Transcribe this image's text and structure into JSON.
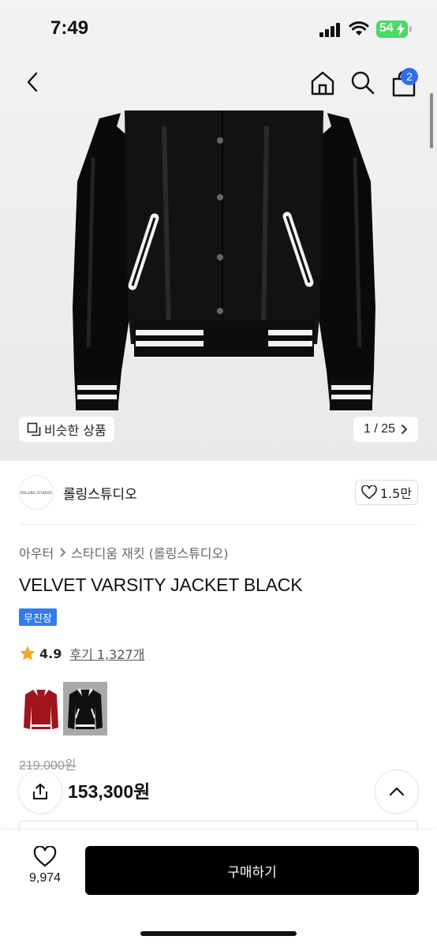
{
  "status_bar": {
    "time": "7:49",
    "battery": "54"
  },
  "nav": {
    "back_icon": "chevron-left-icon",
    "home_icon": "home-icon",
    "search_icon": "search-icon",
    "cart_icon": "shopping-bag-icon",
    "cart_badge": "2"
  },
  "gallery": {
    "similar_label": "비슷한 상품",
    "pager": "1 / 25"
  },
  "brand": {
    "logo_text": "ROLLING STUDIOS",
    "name": "롤링스튜디오",
    "likes": "1.5만"
  },
  "product": {
    "breadcrumb": [
      "아우터",
      "스타디움 재킷 (롤링스튜디오)"
    ],
    "title": "VELVET VARSITY JACKET BLACK",
    "tag": "무진장",
    "rating": "4.9",
    "review_link": "후기 1,327개",
    "original_price": "219,000원",
    "sale_price": "153,300원"
  },
  "bottom_bar": {
    "wish_count": "9,974",
    "buy_label": "구매하기"
  },
  "colors": {
    "accent_blue": "#2f6cf0",
    "tag_blue": "#2f7cf0",
    "buy_button": "#000000",
    "star": "#f5a623"
  }
}
